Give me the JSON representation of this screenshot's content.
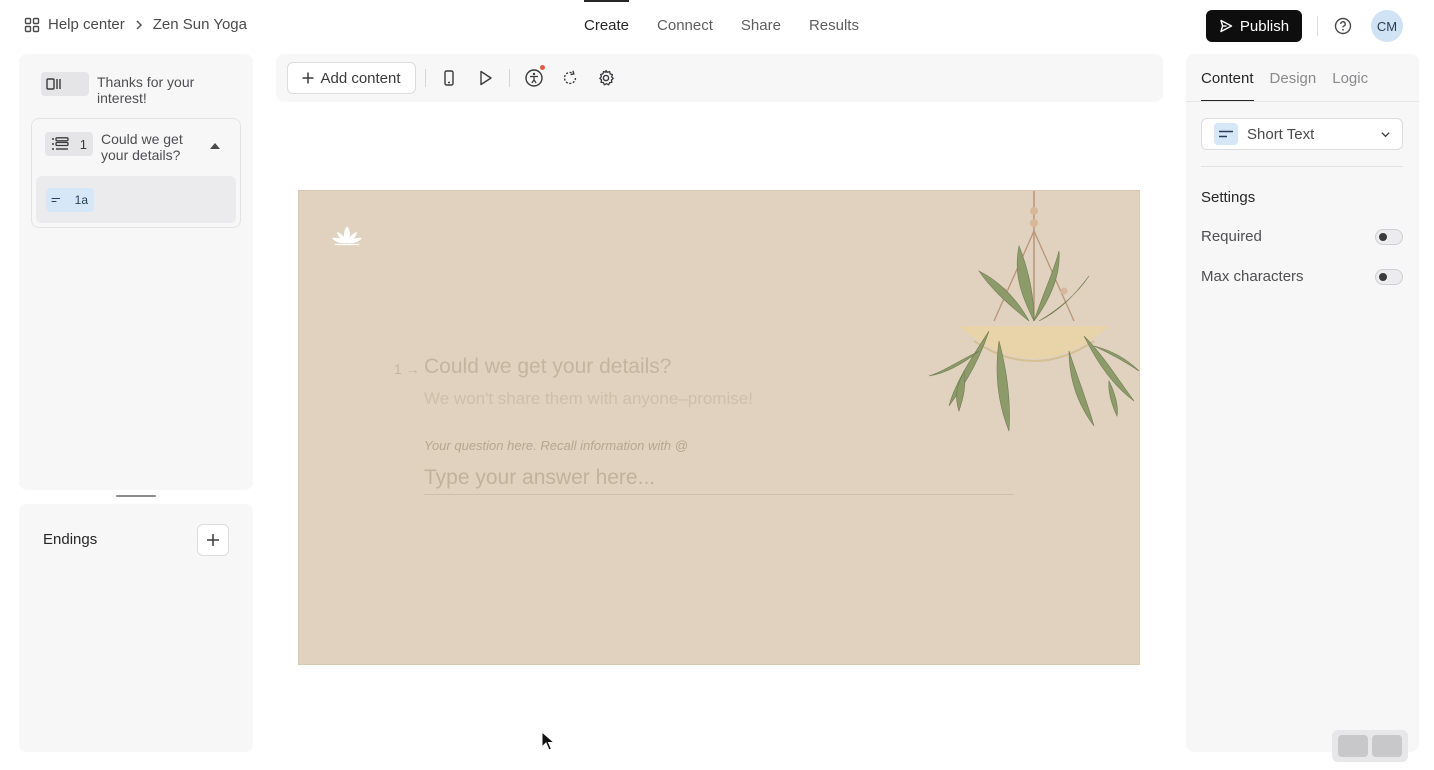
{
  "header": {
    "breadcrumb": {
      "root": "Help center",
      "current": "Zen Sun Yoga"
    },
    "tabs": [
      {
        "label": "Create",
        "active": true
      },
      {
        "label": "Connect",
        "active": false
      },
      {
        "label": "Share",
        "active": false
      },
      {
        "label": "Results",
        "active": false
      }
    ],
    "publish_label": "Publish",
    "avatar_initials": "CM"
  },
  "sidebar": {
    "welcome_card": {
      "text": "Thanks for your interest!",
      "icon": "welcome-screen-icon"
    },
    "question_group": {
      "number": "1",
      "text": "Could we get your details?",
      "icon": "multi-question-icon",
      "subquestion": {
        "label": "1a",
        "icon": "short-text-icon"
      }
    },
    "endings_label": "Endings"
  },
  "toolbar": {
    "add_content_label": "Add content",
    "icons": [
      "mobile-preview-icon",
      "play-icon",
      "accessibility-icon",
      "loop-icon",
      "settings-icon"
    ]
  },
  "canvas": {
    "question_number": "1",
    "title": "Could we get your details?",
    "subtitle": "We won't share them with anyone–promise!",
    "hint": "Your question here. Recall information with @",
    "answer_placeholder": "Type your answer here...",
    "background_color": "#e0d2bf"
  },
  "properties": {
    "tabs": [
      {
        "label": "Content",
        "active": true
      },
      {
        "label": "Design",
        "active": false
      },
      {
        "label": "Logic",
        "active": false
      }
    ],
    "question_type": "Short Text",
    "settings_heading": "Settings",
    "settings": [
      {
        "label": "Required",
        "enabled": false
      },
      {
        "label": "Max characters",
        "enabled": false
      }
    ]
  },
  "colors": {
    "publish_bg": "#0e0e0e",
    "accent_badge": "#d6e7f8",
    "avatar_bg": "#cfe3f5"
  }
}
